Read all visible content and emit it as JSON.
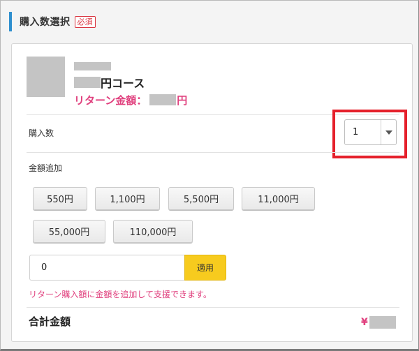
{
  "section": {
    "title": "購入数選択",
    "required_badge": "必須"
  },
  "course": {
    "name_suffix": "円コース",
    "return_label": "リターン金額：",
    "return_suffix": "円"
  },
  "quantity": {
    "label": "購入数",
    "selected": "1"
  },
  "add_amount": {
    "label": "金額追加",
    "buttons": [
      "550円",
      "1,100円",
      "5,500円",
      "11,000円",
      "55,000円",
      "110,000円"
    ],
    "input_value": "0",
    "apply_label": "適用",
    "hint": "リターン購入額に金額を追加して支援できます。"
  },
  "total": {
    "label": "合計金額",
    "currency": "¥"
  },
  "colors": {
    "accent_blue": "#2e8fcf",
    "pink": "#e0407e",
    "highlight_red": "#e5202b",
    "apply_yellow": "#f7cb1e",
    "required_red": "#d9323d"
  }
}
